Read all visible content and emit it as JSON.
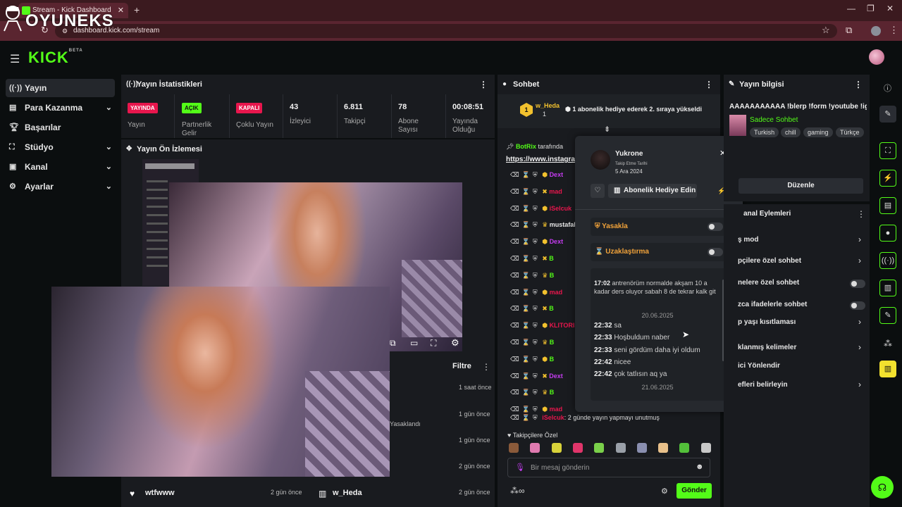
{
  "browser": {
    "tab_title": "Stream - Kick Dashboard",
    "url": "dashboard.kick.com/stream"
  },
  "watermark": {
    "text": "OYUNEKS"
  },
  "header": {
    "logo": "KICK",
    "logo_badge": "BETA"
  },
  "sidebar": {
    "items": [
      {
        "label": "Yayın",
        "icon": "broadcast-icon"
      },
      {
        "label": "Para Kazanma",
        "icon": "money-icon"
      },
      {
        "label": "Başarılar",
        "icon": "trophy-icon"
      },
      {
        "label": "Stüdyo",
        "icon": "studio-icon"
      },
      {
        "label": "Kanal",
        "icon": "channel-icon"
      },
      {
        "label": "Ayarlar",
        "icon": "settings-icon"
      }
    ]
  },
  "stats": {
    "title": "Yayın İstatistikleri",
    "badges": [
      {
        "text": "YAYINDA",
        "label": "Yayın",
        "color": "#e8164d"
      },
      {
        "text": "AÇIK",
        "label": "Partnerlik Gelir",
        "color": "#53fc18"
      },
      {
        "text": "KAPALI",
        "label": "Çoklu Yayın",
        "color": "#e8164d"
      }
    ],
    "numbers": [
      {
        "value": "43",
        "label": "İzleyici"
      },
      {
        "value": "6.811",
        "label": "Takipçi"
      },
      {
        "value": "78",
        "label": "Abone Sayısı"
      },
      {
        "value": "00:08:51",
        "label": "Yayında Olduğu"
      }
    ]
  },
  "preview": {
    "title": "Yayın Ön İzlemesi"
  },
  "activity": {
    "filter_label": "Filtre",
    "times": [
      "1 saat önce",
      "1 gün önce",
      "1 gün önce",
      "2 gün önce",
      "2 gün önce",
      "2 gün önce"
    ],
    "partial_text": "Yasaklandı",
    "user_left": "wtfwww",
    "user_right": "w_Heda"
  },
  "chat": {
    "title": "Sohbet",
    "pinned_user": "w_Heda",
    "pinned_count": "1",
    "pinned_text": "1 abonelik hediye ederek 2. sıraya yükseldi",
    "pin_author": "BotRix",
    "pin_author_suffix": "tarafında",
    "pin_link": "https://www.instagram",
    "rows": [
      {
        "name": "Dext",
        "color": "#c43cf0"
      },
      {
        "name": "mad",
        "color": "#e8164d"
      },
      {
        "name": "iSelcuk",
        "color": "#e8164d"
      },
      {
        "name": "mustafaken",
        "color": "#e6e6e6"
      },
      {
        "name": "Dext",
        "color": "#c43cf0"
      },
      {
        "name": "B",
        "color": "#53fc18"
      },
      {
        "name": "B",
        "color": "#53fc18"
      },
      {
        "name": "mad",
        "color": "#e8164d"
      },
      {
        "name": "B",
        "color": "#53fc18"
      },
      {
        "name": "KLITORIS_D",
        "color": "#e8164d"
      },
      {
        "name": "B",
        "color": "#53fc18"
      },
      {
        "name": "B",
        "color": "#53fc18"
      },
      {
        "name": "Dext",
        "color": "#c43cf0"
      },
      {
        "name": "B",
        "color": "#53fc18"
      },
      {
        "name": "mad",
        "color": "#e8164d"
      }
    ],
    "last_row_user": "iSelcuk",
    "last_row_text": ": 2 günde yayın yapmayı unutmuş",
    "followers_only": "Takipçilere Özel",
    "input_placeholder": "Bir mesaj gönderin",
    "send_label": "Gönder"
  },
  "popup": {
    "username": "Yukrone",
    "follow_label": "Takip Etme Tarihi",
    "follow_date": "5 Ara 2024",
    "gift_label": "Abonelik Hediye Edin",
    "ban_label": "Yasakla",
    "timeout_label": "Uzaklaştırma",
    "history_first": {
      "time": "17:02",
      "text": "antrenörüm normalde akşam 10 a kadar ders oluyor sabah 8 de tekrar kalk git"
    },
    "date1": "20.06.2025",
    "history": [
      {
        "time": "22:32",
        "text": "sa"
      },
      {
        "time": "22:33",
        "text": "Hoşbuldum naber"
      },
      {
        "time": "22:33",
        "text": "seni gördüm daha iyi oldum"
      },
      {
        "time": "22:42",
        "text": "nicee"
      },
      {
        "time": "22:42",
        "text": "çok tatlısın aq ya"
      }
    ],
    "date2": "21.06.2025"
  },
  "info": {
    "title": "Yayın bilgisi",
    "stream_title": "AAAAAAAAAAA !blerp !form !youtube !ig",
    "category": "Sadece Sohbet",
    "tags": [
      "Turkish",
      "chill",
      "gaming",
      "Türkçe"
    ],
    "edit_label": "Düzenle",
    "actions_title": "anal Eylemleri",
    "actions": [
      {
        "label": "ş mod",
        "control": "chevron"
      },
      {
        "label": "pçilere özel sohbet",
        "control": "chevron"
      },
      {
        "label": "nelere özel sohbet",
        "control": "toggle"
      },
      {
        "label": "zca ifadelerle sohbet",
        "control": "toggle"
      },
      {
        "label": "p yaşı kısıtlaması",
        "control": "chevron"
      },
      {
        "label": "klanmış kelimeler",
        "control": "chevron"
      },
      {
        "label": "ici Yönlendir",
        "control": "none"
      },
      {
        "label": "efleri belirleyin",
        "control": "chevron"
      }
    ]
  },
  "colors": {
    "accent": "#53fc18",
    "live": "#e8164d",
    "panel": "#191b1f",
    "bg": "#0b0e0f"
  }
}
